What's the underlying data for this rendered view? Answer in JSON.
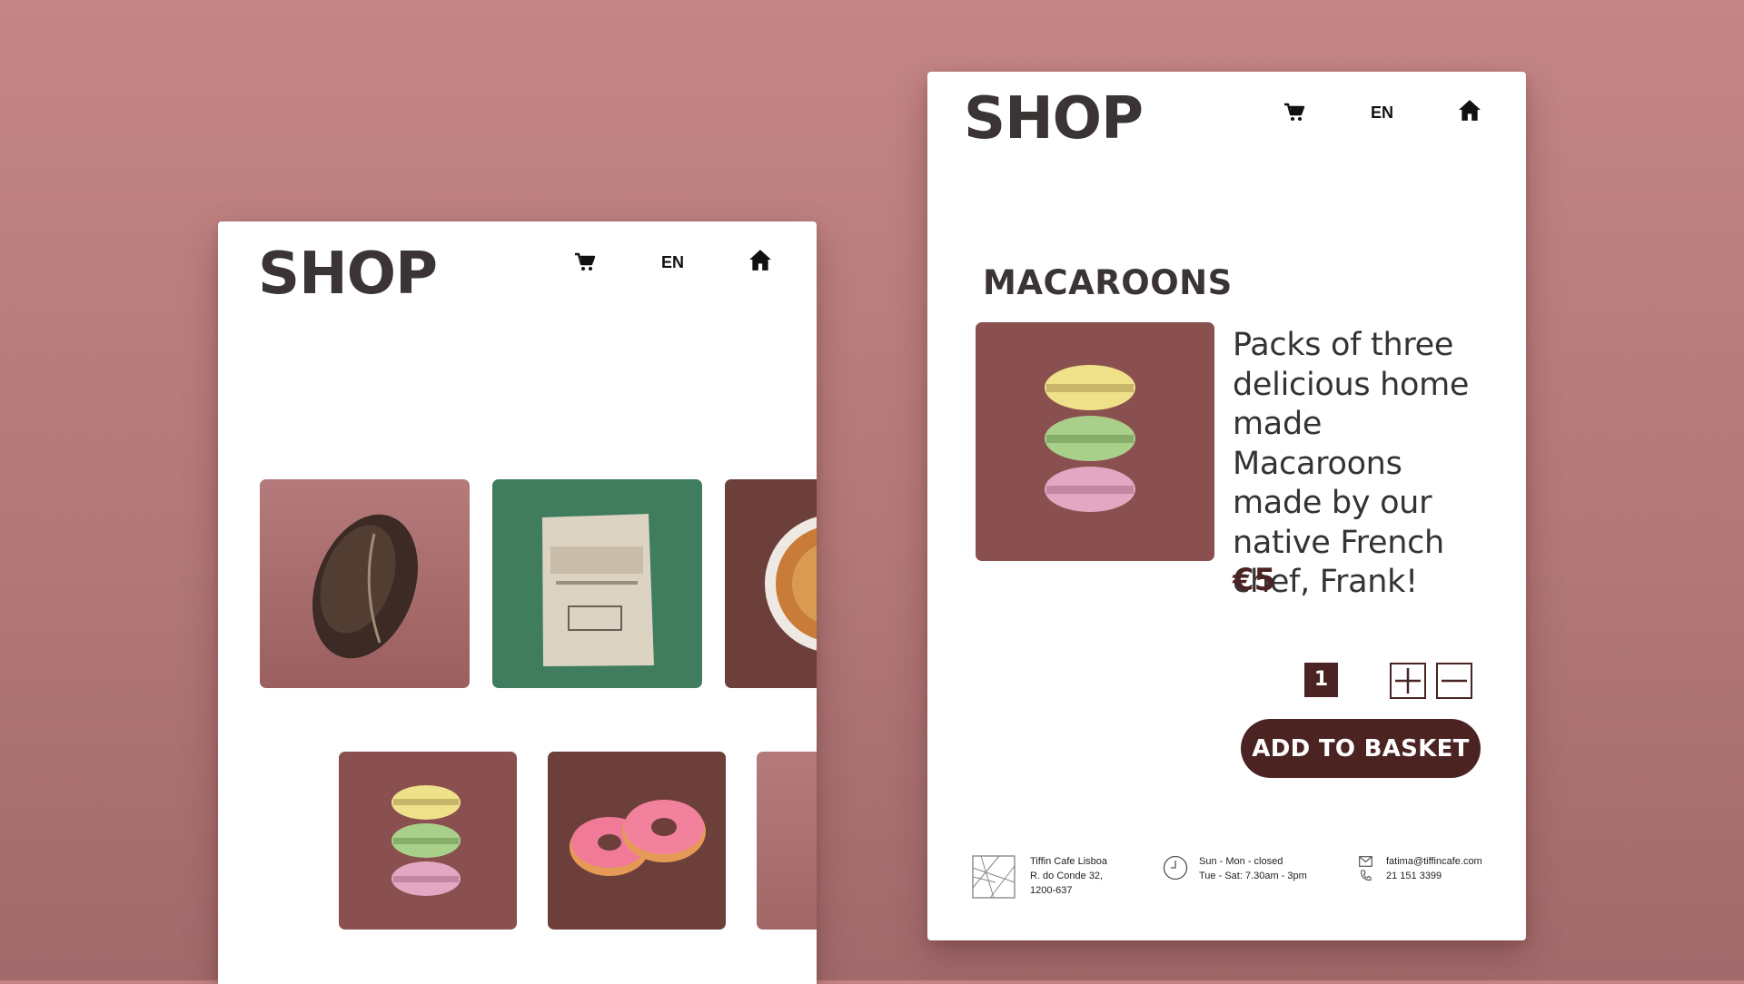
{
  "list_screen": {
    "title": "SHOP",
    "lang": "EN",
    "icons": [
      "cart-icon",
      "home-icon"
    ],
    "products": [
      {
        "name": "bread",
        "icon": "bread-image"
      },
      {
        "name": "coffee",
        "icon": "coffee-beans-image"
      },
      {
        "name": "pie",
        "icon": "apple-pie-image"
      },
      {
        "name": "macaroons",
        "icon": "macaroons-image"
      },
      {
        "name": "donuts",
        "icon": "donuts-image"
      },
      {
        "name": "more",
        "icon": "product-image"
      }
    ]
  },
  "detail_screen": {
    "title": "SHOP",
    "lang": "EN",
    "product": {
      "heading": "MACAROONS",
      "description": "Packs of three delicious home made Macaroons made by our native French chef, Frank!",
      "price": "€5"
    },
    "quantity": "1",
    "add_button": "ADD TO BASKET",
    "footer": {
      "address_name": "Tiffin Cafe Lisboa",
      "address_street": "R. do Conde 32,",
      "address_postcode": "1200-637",
      "hours_line1": "Sun - Mon - closed",
      "hours_line2": "Tue - Sat:  7.30am - 3pm",
      "email": "fatima@tiffincafe.com",
      "phone": "21 151 3399"
    }
  },
  "colors": {
    "background": "#b97c7d",
    "accent": "#4a2322",
    "title": "#3a3434"
  }
}
